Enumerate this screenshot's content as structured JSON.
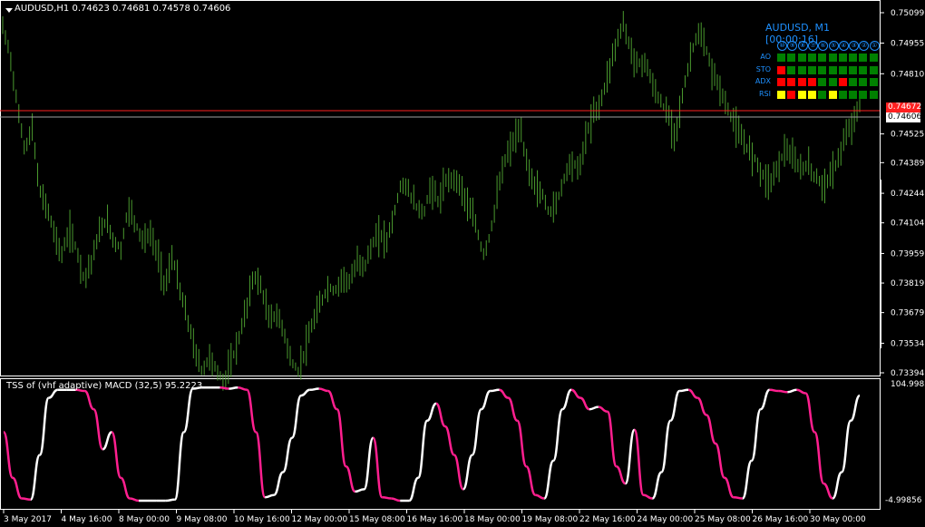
{
  "window": {
    "title": "AUDUSD,H1  0.74623 0.74681 0.74578 0.74606",
    "indicator_title": "TSS of (vhf adaptive) MACD (32,5) 95.2223"
  },
  "price_scale": {
    "labels": [
      "0.75099",
      "0.74955",
      "0.74810",
      "0.74672",
      "0.74606",
      "0.74525",
      "0.74389",
      "0.74244",
      "0.74104",
      "0.73959",
      "0.73819",
      "0.73679",
      "0.73534",
      "0.73394"
    ],
    "current_price": "0.74606",
    "red_tag": "0.74672"
  },
  "indicator_scale": {
    "top": "104.9985",
    "bottom": "-4.99856"
  },
  "time_axis": {
    "labels": [
      "3 May 2017",
      "4 May 16:00",
      "8 May 00:00",
      "9 May 08:00",
      "10 May 16:00",
      "12 May 00:00",
      "15 May 08:00",
      "16 May 16:00",
      "18 May 00:00",
      "19 May 08:00",
      "22 May 16:00",
      "24 May 00:00",
      "25 May 08:00",
      "26 May 16:00",
      "30 May 00:00"
    ]
  },
  "dashboard": {
    "title": "AUDUSD, M1 [00:00:16]",
    "timeframes": [
      "⑩",
      "⑨",
      "⑧",
      "⑦",
      "⑥",
      "⑤",
      "④",
      "③",
      "②",
      "①"
    ],
    "rows": [
      {
        "label": "AO",
        "cells": [
          "green",
          "green",
          "green",
          "green",
          "green",
          "green",
          "green",
          "green",
          "green",
          "green"
        ]
      },
      {
        "label": "STO",
        "cells": [
          "red",
          "green",
          "green",
          "green",
          "green",
          "green",
          "green",
          "green",
          "green",
          "green"
        ]
      },
      {
        "label": "ADX",
        "cells": [
          "red",
          "red",
          "red",
          "red",
          "green",
          "green",
          "red",
          "green",
          "green",
          "green"
        ]
      },
      {
        "label": "RSI",
        "cells": [
          "yellow",
          "red",
          "yellow",
          "yellow",
          "green",
          "yellow",
          "green",
          "green",
          "green",
          "green"
        ]
      }
    ]
  },
  "colors": {
    "background": "#000000",
    "candles": "#4a9a2e",
    "tss_up": "#ffffff",
    "tss_down": "#ff1f8f",
    "red_line": "#ff2020",
    "cell_green": "#008000",
    "cell_red": "#ff0000",
    "cell_yellow": "#ffff00",
    "accent": "#1e90ff"
  },
  "price_series": [
    0.7503,
    0.749,
    0.7465,
    0.7445,
    0.7455,
    0.7425,
    0.7418,
    0.7405,
    0.7395,
    0.7407,
    0.7398,
    0.7384,
    0.7392,
    0.7405,
    0.7412,
    0.7402,
    0.7398,
    0.7418,
    0.741,
    0.7402,
    0.7405,
    0.7395,
    0.738,
    0.7395,
    0.7378,
    0.7365,
    0.735,
    0.734,
    0.7347,
    0.734,
    0.7335,
    0.7345,
    0.7356,
    0.737,
    0.7386,
    0.738,
    0.7365,
    0.7367,
    0.736,
    0.7345,
    0.734,
    0.7351,
    0.7363,
    0.7372,
    0.738,
    0.7378,
    0.7385,
    0.7382,
    0.7392,
    0.739,
    0.74,
    0.7405,
    0.7402,
    0.7415,
    0.743,
    0.7425,
    0.7418,
    0.7415,
    0.7428,
    0.742,
    0.743,
    0.7432,
    0.7428,
    0.7418,
    0.741,
    0.7395,
    0.7405,
    0.7425,
    0.744,
    0.7448,
    0.7455,
    0.7438,
    0.7428,
    0.7424,
    0.7415,
    0.742,
    0.7432,
    0.744,
    0.7435,
    0.7452,
    0.7462,
    0.7468,
    0.7482,
    0.7495,
    0.7505,
    0.7492,
    0.7485,
    0.7487,
    0.7475,
    0.7468,
    0.7462,
    0.7452,
    0.747,
    0.7488,
    0.75,
    0.7495,
    0.7482,
    0.7475,
    0.7465,
    0.7458,
    0.745,
    0.7445,
    0.744,
    0.7432,
    0.743,
    0.7438,
    0.7446,
    0.744,
    0.7436,
    0.7438,
    0.7432,
    0.7428,
    0.7432,
    0.744,
    0.745,
    0.7458,
    0.7465
  ],
  "tss_series": [
    60,
    20,
    2,
    1,
    40,
    90,
    97,
    97,
    97,
    96,
    80,
    45,
    60,
    20,
    2,
    0,
    0,
    0,
    0,
    1,
    60,
    98,
    99,
    99,
    99,
    98,
    99,
    97,
    60,
    3,
    5,
    25,
    55,
    92,
    97,
    98,
    96,
    80,
    30,
    8,
    10,
    55,
    3,
    2,
    0,
    0,
    20,
    70,
    85,
    65,
    40,
    10,
    40,
    80,
    96,
    97,
    90,
    70,
    30,
    5,
    2,
    35,
    80,
    97,
    90,
    80,
    82,
    78,
    30,
    15,
    62,
    5,
    2,
    25,
    70,
    96,
    97,
    90,
    75,
    50,
    20,
    3,
    2,
    35,
    80,
    97,
    96,
    95,
    97,
    94,
    60,
    15,
    2,
    25,
    70,
    92
  ]
}
